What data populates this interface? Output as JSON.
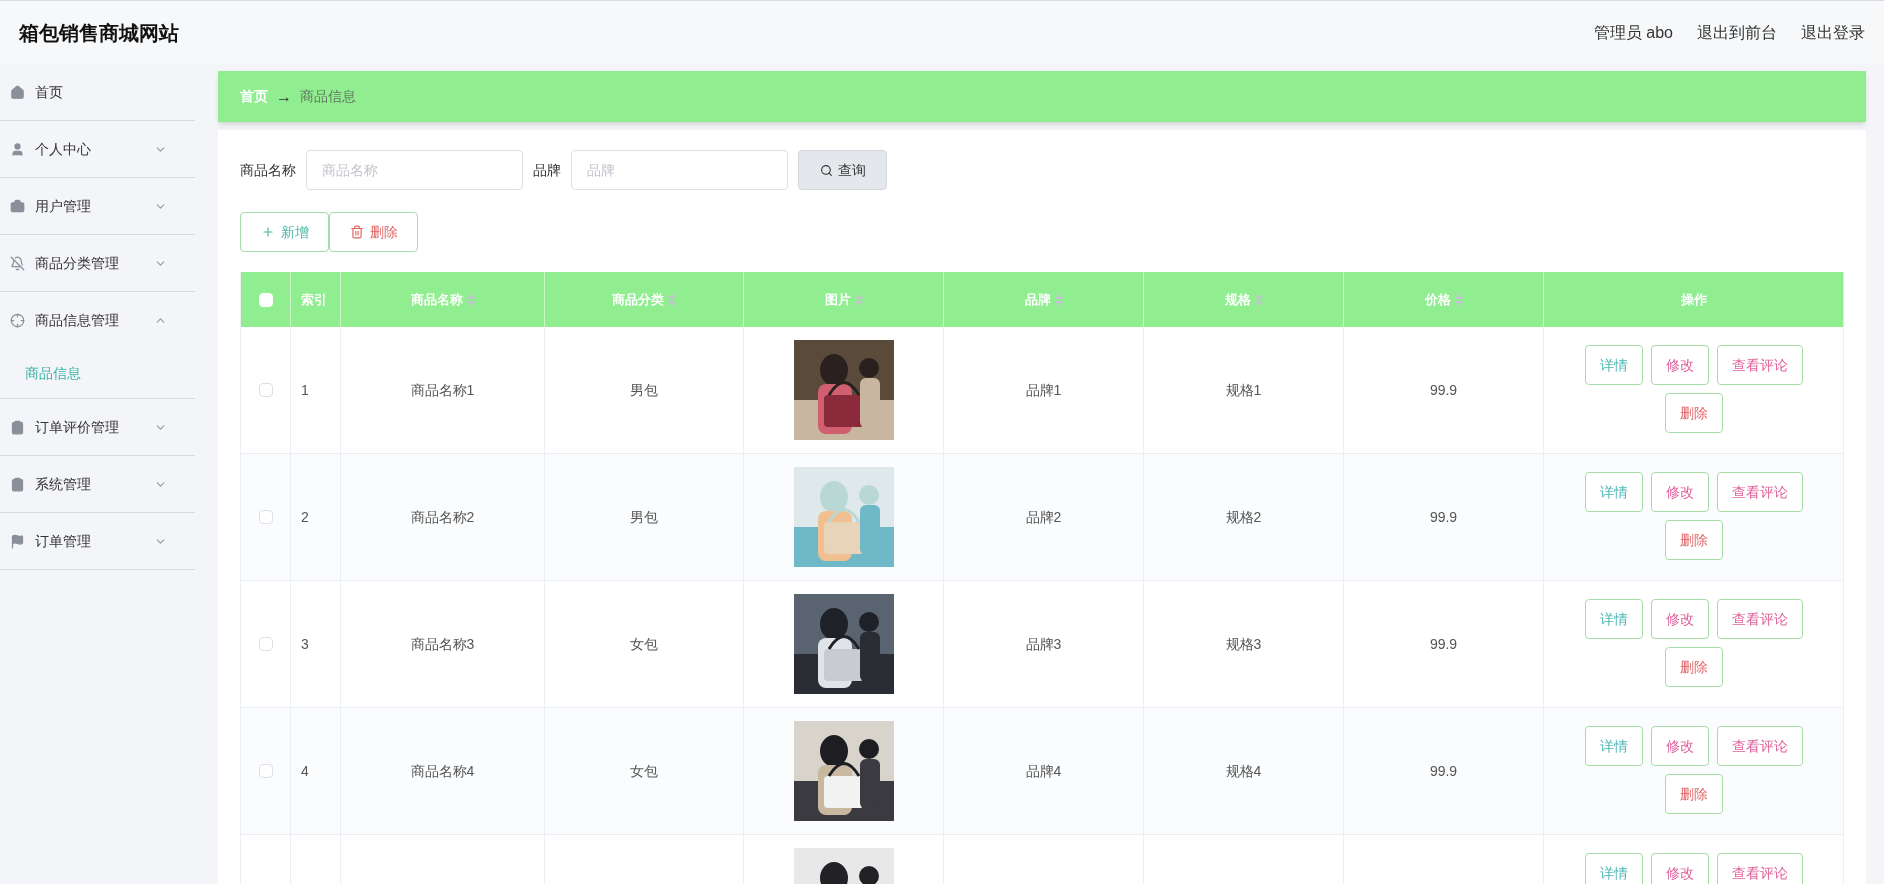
{
  "header": {
    "title": "箱包销售商城网站",
    "links": [
      "管理员 abo",
      "退出到前台",
      "退出登录"
    ]
  },
  "sidebar": {
    "items": [
      {
        "label": "首页"
      },
      {
        "label": "个人中心",
        "expanded": false
      },
      {
        "label": "用户管理",
        "expanded": false
      },
      {
        "label": "商品分类管理",
        "expanded": false
      },
      {
        "label": "商品信息管理",
        "expanded": true,
        "children": [
          {
            "label": "商品信息",
            "selected": true
          }
        ]
      },
      {
        "label": "订单评价管理",
        "expanded": false
      },
      {
        "label": "系统管理",
        "expanded": false
      },
      {
        "label": "订单管理",
        "expanded": false
      }
    ]
  },
  "breadcrumb": {
    "separator": "→",
    "items": [
      "首页",
      "商品信息"
    ]
  },
  "search": {
    "fields": [
      {
        "label": "商品名称",
        "placeholder": "商品名称"
      },
      {
        "label": "品牌",
        "placeholder": "品牌"
      }
    ],
    "button": "查询"
  },
  "toolbar": [
    {
      "kind": "add",
      "label": "新增"
    },
    {
      "kind": "delete",
      "label": "删除"
    }
  ],
  "table": {
    "select_all": {
      "checked": false
    },
    "columns": [
      {
        "label": "索引",
        "sortable": false
      },
      {
        "label": "商品名称",
        "sortable": true
      },
      {
        "label": "商品分类",
        "sortable": true
      },
      {
        "label": "图片",
        "sortable": true
      },
      {
        "label": "品牌",
        "sortable": true
      },
      {
        "label": "规格",
        "sortable": true
      },
      {
        "label": "价格",
        "sortable": true
      },
      {
        "label": "操作",
        "sortable": false
      }
    ],
    "rows": [
      {
        "checked": false,
        "index": "1",
        "name": "商品名称1",
        "category": "男包",
        "picture": {
          "kind": "picture"
        },
        "brand": "品牌1",
        "spec": "规格1",
        "price": "99.9",
        "actions": [
          {
            "kind": "detail",
            "label": "详情"
          },
          {
            "kind": "edit",
            "label": "修改"
          },
          {
            "kind": "comments",
            "label": "查看评论"
          },
          {
            "kind": "delete",
            "label": "删除"
          }
        ]
      },
      {
        "checked": false,
        "index": "2",
        "name": "商品名称2",
        "category": "男包",
        "picture": {
          "kind": "picture"
        },
        "brand": "品牌2",
        "spec": "规格2",
        "price": "99.9",
        "actions": [
          {
            "kind": "detail",
            "label": "详情"
          },
          {
            "kind": "edit",
            "label": "修改"
          },
          {
            "kind": "comments",
            "label": "查看评论"
          },
          {
            "kind": "delete",
            "label": "删除"
          }
        ]
      },
      {
        "checked": false,
        "index": "3",
        "name": "商品名称3",
        "category": "女包",
        "picture": {
          "kind": "picture"
        },
        "brand": "品牌3",
        "spec": "规格3",
        "price": "99.9",
        "actions": [
          {
            "kind": "detail",
            "label": "详情"
          },
          {
            "kind": "edit",
            "label": "修改"
          },
          {
            "kind": "comments",
            "label": "查看评论"
          },
          {
            "kind": "delete",
            "label": "删除"
          }
        ]
      },
      {
        "checked": false,
        "index": "4",
        "name": "商品名称4",
        "category": "女包",
        "picture": {
          "kind": "picture"
        },
        "brand": "品牌4",
        "spec": "规格4",
        "price": "99.9",
        "actions": [
          {
            "kind": "detail",
            "label": "详情"
          },
          {
            "kind": "edit",
            "label": "修改"
          },
          {
            "kind": "comments",
            "label": "查看评论"
          },
          {
            "kind": "delete",
            "label": "删除"
          }
        ]
      },
      {
        "picture": {
          "kind": "picture"
        },
        "actions": [
          {
            "kind": "detail",
            "label": "详情"
          },
          {
            "kind": "edit",
            "label": "修改"
          },
          {
            "kind": "comments",
            "label": "查看评论"
          }
        ]
      }
    ]
  }
}
